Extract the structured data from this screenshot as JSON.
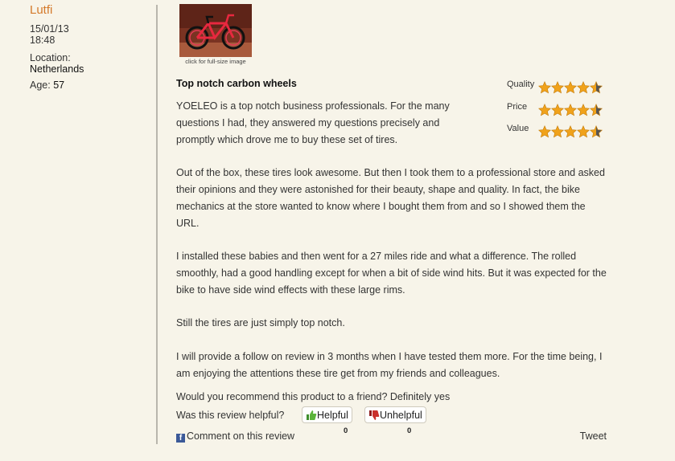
{
  "user": {
    "name": "Lutfi",
    "date": "15/01/13",
    "time": "18:48",
    "location_label": "Location:",
    "location_value": "Netherlands",
    "age_label": "Age:",
    "age_value": "57"
  },
  "review": {
    "thumbnail_caption": "click for full-size image",
    "title": "Top notch carbon wheels",
    "ratings": [
      {
        "label": "Quality",
        "value": 4.5,
        "max": 5
      },
      {
        "label": "Price",
        "value": 4.5,
        "max": 5
      },
      {
        "label": "Value",
        "value": 4.5,
        "max": 5
      }
    ],
    "paragraphs": [
      "YOELEO is a top notch business professionals. For the many questions I had, they answered my questions precisely and promptly which drove me to buy these set of tires.",
      "Out of the box, these tires look awesome. But then I took them to a professional store and asked their opinions and they were astonished for their beauty, shape and quality. In fact, the bike mechanics at the store wanted to know where I bought them from and so I showed them the URL.",
      "I installed these babies and then went for a 27 miles ride and what a difference. The rolled smoothly, had a good handling except for when a bit of side wind hits. But it was expected for the bike to have side wind effects with these large rims.",
      "Still the tires are just simply top notch.",
      "I will provide a follow on review in 3 months when I have tested them more. For the time being, I am enjoying the attentions these tire get from my friends and colleagues."
    ],
    "recommend": "Would you recommend this product to a friend? Definitely yes",
    "helpful_question": "Was this review helpful?",
    "helpful_label": "Helpful",
    "helpful_count": "0",
    "unhelpful_label": "Unhelpful",
    "unhelpful_count": "0",
    "comment_link": "Comment on this review",
    "tweet": "Tweet"
  },
  "colors": {
    "background": "#f7f4e9",
    "username": "#d4792a",
    "star": "#f0a21b",
    "facebook": "#3b5998"
  }
}
